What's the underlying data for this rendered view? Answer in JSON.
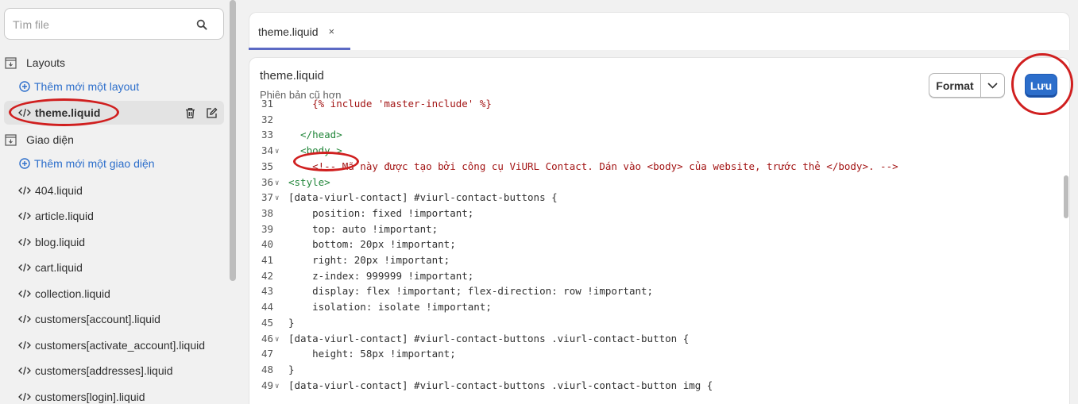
{
  "sidebar": {
    "search_placeholder": "Tìm file",
    "layouts_label": "Layouts",
    "add_layout": "Thêm mới một layout",
    "active_file": "theme.liquid",
    "templates_label": "Giao diện",
    "add_template": "Thêm mới một giao diện",
    "files": [
      "404.liquid",
      "article.liquid",
      "blog.liquid",
      "cart.liquid",
      "collection.liquid",
      "customers[account].liquid",
      "customers[activate_account].liquid",
      "customers[addresses].liquid",
      "customers[login].liquid"
    ]
  },
  "tab": {
    "label": "theme.liquid",
    "close": "×"
  },
  "editor": {
    "title": "theme.liquid",
    "subtitle": "Phiên bản cũ hơn",
    "format_label": "Format",
    "save_label": "Lưu"
  },
  "code_lines": [
    {
      "n": "31",
      "text": "    {% include 'master-include' %}"
    },
    {
      "n": "32",
      "text": ""
    },
    {
      "n": "33",
      "text": "  </head>"
    },
    {
      "n": "34",
      "text": "  <body >"
    },
    {
      "n": "35",
      "text": "    <!-- Mã này được tạo bởi công cụ ViURL Contact. Dán vào <body> của website, trước thẻ </body>. -->"
    },
    {
      "n": "36",
      "text": "<style>"
    },
    {
      "n": "37",
      "text": "[data-viurl-contact] #viurl-contact-buttons {"
    },
    {
      "n": "38",
      "text": "    position: fixed !important;"
    },
    {
      "n": "39",
      "text": "    top: auto !important;"
    },
    {
      "n": "40",
      "text": "    bottom: 20px !important;"
    },
    {
      "n": "41",
      "text": "    right: 20px !important;"
    },
    {
      "n": "42",
      "text": "    z-index: 999999 !important;"
    },
    {
      "n": "43",
      "text": "    display: flex !important; flex-direction: row !important;"
    },
    {
      "n": "44",
      "text": "    isolation: isolate !important;"
    },
    {
      "n": "45",
      "text": "}"
    },
    {
      "n": "46",
      "text": "[data-viurl-contact] #viurl-contact-buttons .viurl-contact-button {"
    },
    {
      "n": "47",
      "text": "    height: 58px !important;"
    },
    {
      "n": "48",
      "text": "}"
    },
    {
      "n": "49",
      "text": "[data-viurl-contact] #viurl-contact-buttons .viurl-contact-button img {"
    }
  ],
  "colors": {
    "accent": "#2c6ecb",
    "annotation": "#d01f1f",
    "tab_underline": "#5c6ac4"
  }
}
